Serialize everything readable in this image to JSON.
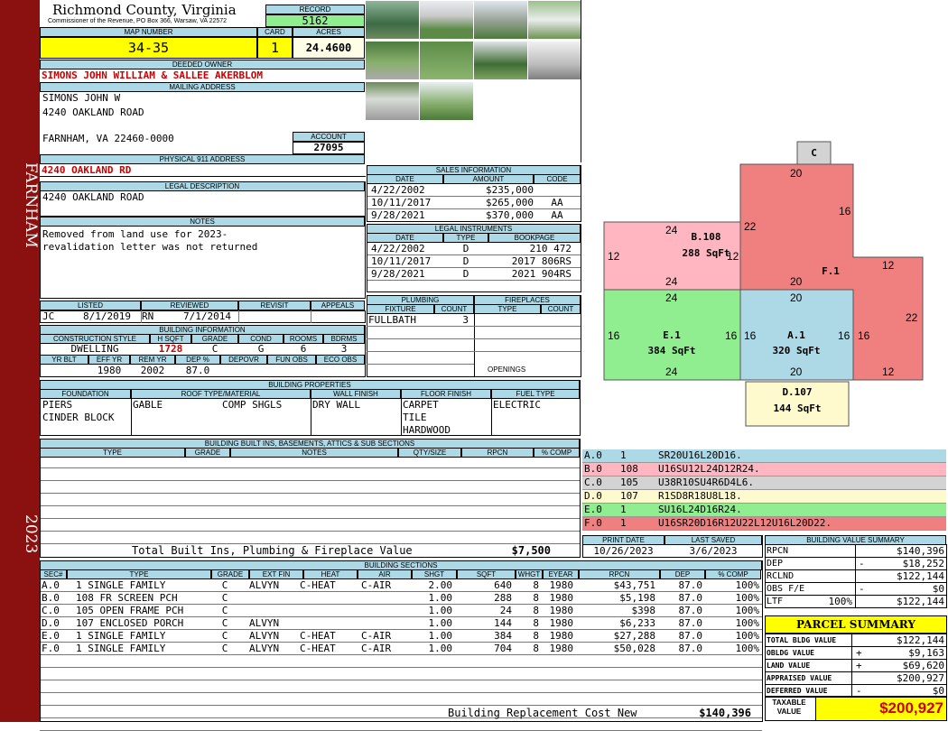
{
  "sidebar": {
    "place": "FARNHAM",
    "year": "2023"
  },
  "header": {
    "county": "Richmond County, Virginia",
    "commissioner": "Commissioner of the Revenue, PO Box 366, Warsaw, VA 22572"
  },
  "record": {
    "label": "RECORD",
    "value": "5162"
  },
  "map": {
    "label": "MAP NUMBER",
    "value": "34-35"
  },
  "card": {
    "label": "CARD",
    "value": "1"
  },
  "acres": {
    "label": "ACRES",
    "value": "24.4600"
  },
  "owner": {
    "label": "DEEDED OWNER",
    "value": "SIMONS JOHN WILLIAM & SALLEE AKERBLOM"
  },
  "mailing": {
    "label": "MAILING ADDRESS",
    "line1": "SIMONS JOHN W",
    "line2": "4240 OAKLAND ROAD",
    "line3": "FARNHAM, VA 22460-0000"
  },
  "account": {
    "label": "ACCOUNT",
    "value": "27095"
  },
  "physical": {
    "label": "PHYSICAL 911 ADDRESS",
    "value": "4240 OAKLAND RD"
  },
  "legal": {
    "label": "LEGAL DESCRIPTION",
    "value": "4240 OAKLAND ROAD"
  },
  "notes": {
    "label": "NOTES",
    "line1": "Removed from land use for 2023-",
    "line2": "revalidation letter was not returned"
  },
  "review": {
    "listed": "LISTED",
    "reviewed": "REVIEWED",
    "revisit": "REVISIT",
    "appeals": "APPEALS",
    "l_by": "JC",
    "l_date": "8/1/2019",
    "r_by": "RN",
    "r_date": "7/1/2014"
  },
  "bldg_info": {
    "title": "BUILDING INFORMATION",
    "h_style": "CONSTRUCTION STYLE",
    "h_sqft": "H SQFT",
    "h_grade": "GRADE",
    "h_cond": "COND",
    "h_rooms": "ROOMS",
    "h_bdrms": "BDRMS",
    "style": "DWELLING",
    "sqft": "1728",
    "grade": "C",
    "cond": "G",
    "rooms": "6",
    "bdrms": "3",
    "h_yrblt": "YR BLT",
    "h_effyr": "EFF YR",
    "h_remyr": "REM YR",
    "h_dep": "DEP %",
    "h_depovr": "DEPOVR",
    "h_funobs": "FUN OBS",
    "h_ecoobs": "ECO OBS",
    "effyr": "1980",
    "remyr": "2002",
    "dep": "87.0"
  },
  "sales": {
    "title": "SALES INFORMATION",
    "h_date": "DATE",
    "h_amount": "AMOUNT",
    "h_code": "CODE",
    "rows": [
      {
        "date": "4/22/2002",
        "amount": "$235,000",
        "code": ""
      },
      {
        "date": "10/11/2017",
        "amount": "$265,000",
        "code": "AA"
      },
      {
        "date": "9/28/2021",
        "amount": "$370,000",
        "code": "AA"
      }
    ]
  },
  "instruments": {
    "title": "LEGAL INSTRUMENTS",
    "h_date": "DATE",
    "h_type": "TYPE",
    "h_book": "BOOKPAGE",
    "rows": [
      {
        "date": "4/22/2002",
        "type": "D",
        "book": "210 472"
      },
      {
        "date": "10/11/2017",
        "type": "D",
        "book": "2017 806RS"
      },
      {
        "date": "9/28/2021",
        "type": "D",
        "book": "2021 904RS"
      }
    ]
  },
  "plumbing": {
    "title": "PLUMBING",
    "h_fixture": "FIXTURE",
    "h_count": "COUNT",
    "fixture": "FULLBATH",
    "count": "3"
  },
  "fireplaces": {
    "title": "FIREPLACES",
    "h_type": "TYPE",
    "h_count": "COUNT",
    "openings": "OPENINGS"
  },
  "props": {
    "title": "BUILDING PROPERTIES",
    "h_found": "FOUNDATION",
    "h_roof": "ROOF TYPE/MATERIAL",
    "h_wall": "WALL FINISH",
    "h_floor": "FLOOR FINISH",
    "h_fuel": "FUEL TYPE",
    "found1": "PIERS",
    "found2": "CINDER BLOCK",
    "roof1": "GABLE",
    "roof2": "COMP SHGLS",
    "wall": "DRY WALL",
    "floor1": "CARPET",
    "floor2": "TILE",
    "floor3": "HARDWOOD",
    "fuel": "ELECTRIC"
  },
  "builtins": {
    "title": "BUILDING BUILT INS, BASEMENTS, ATTICS & SUB SECTIONS",
    "h_type": "TYPE",
    "h_grade": "GRADE",
    "h_notes": "NOTES",
    "h_qty": "QTY/SIZE",
    "h_rpcn": "RPCN",
    "h_comp": "% COMP",
    "total_label": "Total Built Ins, Plumbing & Fireplace Value",
    "total": "$7,500"
  },
  "dates": {
    "h_print": "PRINT DATE",
    "h_saved": "LAST SAVED",
    "print": "10/26/2023",
    "saved": "3/6/2023"
  },
  "sections": {
    "title": "BUILDING SECTIONS",
    "headers": [
      "SEC#",
      "TYPE",
      "GRADE",
      "EXT FIN",
      "HEAT",
      "AIR",
      "SHGT",
      "SQFT",
      "WHGT",
      "EYEAR",
      "RPCN",
      "DEP",
      "% COMP"
    ],
    "rows": [
      [
        "A.0",
        "1 SINGLE FAMILY",
        "C",
        "ALVYN",
        "C-HEAT",
        "C-AIR",
        "2.00",
        "640",
        "8",
        "1980",
        "$43,751",
        "87.0",
        "100%"
      ],
      [
        "B.0",
        "108 FR SCREEN PCH",
        "C",
        "",
        "",
        "",
        "1.00",
        "288",
        "8",
        "1980",
        "$5,198",
        "87.0",
        "100%"
      ],
      [
        "C.0",
        "105 OPEN FRAME PCH",
        "C",
        "",
        "",
        "",
        "1.00",
        "24",
        "8",
        "1980",
        "$398",
        "87.0",
        "100%"
      ],
      [
        "D.0",
        "107 ENCLOSED PORCH",
        "C",
        "ALVYN",
        "",
        "",
        "1.00",
        "144",
        "8",
        "1980",
        "$6,233",
        "87.0",
        "100%"
      ],
      [
        "E.0",
        "1 SINGLE FAMILY",
        "C",
        "ALVYN",
        "C-HEAT",
        "C-AIR",
        "1.00",
        "384",
        "8",
        "1980",
        "$27,288",
        "87.0",
        "100%"
      ],
      [
        "F.0",
        "1 SINGLE FAMILY",
        "C",
        "ALVYN",
        "C-HEAT",
        "C-AIR",
        "1.00",
        "704",
        "8",
        "1980",
        "$50,028",
        "87.0",
        "100%"
      ]
    ],
    "replacement_label": "Building Replacement Cost New",
    "replacement": "$140,396"
  },
  "legend": [
    {
      "sec": "A.0",
      "code": "1",
      "path": "SR20U16L20D16.",
      "color": "#add8e6"
    },
    {
      "sec": "B.0",
      "code": "108",
      "path": "U16SU12L24D12R24.",
      "color": "#ffb6c1"
    },
    {
      "sec": "C.0",
      "code": "105",
      "path": "U38R10SU4R6D4L6.",
      "color": "#d3d3d3"
    },
    {
      "sec": "D.0",
      "code": "107",
      "path": "R1SD8R18U8L18.",
      "color": "#fffacd"
    },
    {
      "sec": "E.0",
      "code": "1",
      "path": "SU16L24D16R24.",
      "color": "#90ee90"
    },
    {
      "sec": "F.0",
      "code": "1",
      "path": "U16SR20D16R12U22L12U16L20D22.",
      "color": "#f08080"
    }
  ],
  "sketch": {
    "c_label": "C",
    "f_label": "F.1",
    "b_name": "B.108",
    "b_area": "288 SqFt",
    "e_name": "E.1",
    "e_area": "384 SqFt",
    "a_name": "A.1",
    "a_area": "320 SqFt",
    "d_name": "D.107",
    "d_area": "144 SqFt",
    "dims": {
      "f_top": "20",
      "f_16": "16",
      "f_22l": "22",
      "f_12t": "12",
      "f_22r": "22",
      "f_12b": "12",
      "b_24t": "24",
      "b_12l": "12",
      "b_12r": "12",
      "b_24b": "24",
      "e_24t": "24",
      "e_16l": "16",
      "e_16r": "16",
      "e_24b": "24",
      "a_20t": "20",
      "a_16l": "16",
      "a_16r": "16",
      "a_20b": "20",
      "f_16b": "16",
      "f_20m": "20"
    }
  },
  "value_summary": {
    "title": "BUILDING VALUE SUMMARY",
    "rpcn_l": "RPCN",
    "rpcn": "$140,396",
    "dep_l": "DEP",
    "dep_s": "-",
    "dep": "$18,252",
    "rclnd_l": "RCLND",
    "rclnd": "$122,144",
    "obs_l": "OBS F/E",
    "obs_s": "-",
    "obs": "$0",
    "ltr_l": "LTF",
    "ltr_p": "100%",
    "ltr": "$122,144"
  },
  "parcel": {
    "title": "PARCEL SUMMARY",
    "tbv_l": "TOTAL BLDG VALUE",
    "tbv": "$122,144",
    "obl_l": "OBLDG VALUE",
    "obl_s": "+",
    "obl": "$9,163",
    "land_l": "LAND VALUE",
    "land_s": "+",
    "land": "$69,620",
    "appr_l": "APPRAISED VALUE",
    "appr": "$200,927",
    "def_l": "DEFERRED VALUE",
    "def_s": "-",
    "def": "$0",
    "tax_l1": "TAXABLE",
    "tax_l2": "VALUE",
    "tax": "$200,927"
  }
}
